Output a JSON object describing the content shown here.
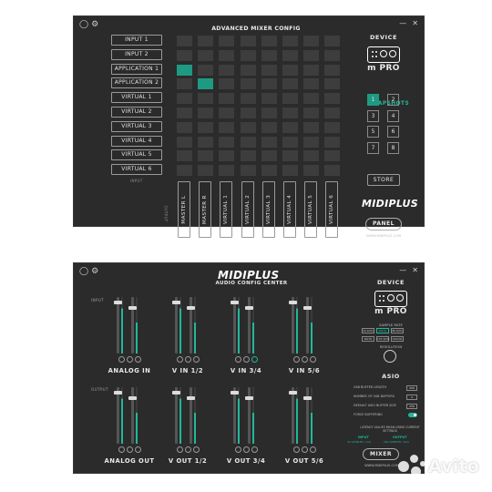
{
  "mixer_panel": {
    "title": "ADVANCED MIXER CONFIG",
    "inputs": [
      "INPUT 1",
      "INPUT 2",
      "APPLICATION 1",
      "APPLICATION 2",
      "VIRTUAL 1",
      "VIRTUAL 2",
      "VIRTUAL 3",
      "VIRTUAL 4",
      "VIRTUAL 5",
      "VIRTUAL 6"
    ],
    "outputs": [
      "MASTER L",
      "MASTER R",
      "VIRTUAL 1",
      "VIRTUAL 2",
      "VIRTUAL 3",
      "VIRTUAL 4",
      "VIRTUAL 5",
      "VIRTUAL 6"
    ],
    "input_axis_label": "INPUT",
    "output_axis_label": "OUTPUT",
    "active_routes": [
      {
        "input": "APPLICATION 1",
        "output": "MASTER L"
      },
      {
        "input": "APPLICATION 2",
        "output": "MASTER R"
      }
    ],
    "device_label": "DEVICE",
    "device_name": "m PRO",
    "snapshots_label": "SNAPSHOTS",
    "snapshots": [
      "1",
      "2",
      "3",
      "4",
      "5",
      "6",
      "7",
      "8"
    ],
    "active_snapshot": "1",
    "store_label": "STORE",
    "brand": "MIDIPLUS",
    "panel_button": "PANEL",
    "url": "WWW.MIDIPLUS.COM"
  },
  "audio_panel": {
    "brand": "MIDIPLUS",
    "title": "AUDIO CONFIG CENTER",
    "input_section_label": "INPUT",
    "output_section_label": "OUTPUT",
    "input_channels": [
      "ANALOG IN",
      "V IN 1/2",
      "V IN 3/4",
      "V IN 5/6"
    ],
    "output_channels": [
      "ANALOG OUT",
      "V OUT 1/2",
      "V OUT 3/4",
      "V OUT 5/6"
    ],
    "device_label": "DEVICE",
    "device_name": "m PRO",
    "sample_rate_label": "SAMPLE RATE",
    "sample_rates": [
      "44.1kHz",
      "48kHz",
      "88.2kHz",
      "96kHz",
      "176.4kHz",
      "192kHz"
    ],
    "active_sample_rate": "48kHz",
    "resolution_label": "RESOLUTION",
    "asio_label": "ASIO",
    "asio_settings": [
      {
        "key": "USB BUFFER LENGTH",
        "value": "256"
      },
      {
        "key": "NUMBER OF USB BUFFERS",
        "value": "4"
      },
      {
        "key": "DEFAULT ASIO BUFFER SIZE",
        "value": "256"
      },
      {
        "key": "FORCE BUFFERING",
        "value": "ON"
      }
    ],
    "latency_note": "LATENCY VALUES MEAN USING CURRENT SETTINGS",
    "input_header": "INPUT",
    "output_header": "OUTPUT",
    "input_latency": "44 SAMPLES / 1ms",
    "output_latency": "264 SAMPLES / 5ms",
    "mixer_button": "MIXER",
    "url": "WWW.MIDIPLUS.COM"
  },
  "watermark": "Avito",
  "colors": {
    "accent": "#1f9a82",
    "panel_bg": "#2b2b2b",
    "cell_bg": "#3d3d3d"
  }
}
